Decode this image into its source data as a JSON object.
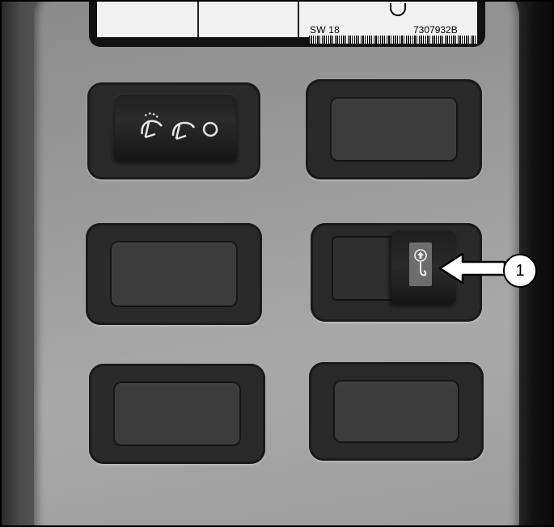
{
  "label_plate": {
    "switch_id": "SW 18",
    "part_number": "7307932B"
  },
  "switch_panel": {
    "slots": [
      {
        "position": "top-left",
        "state": "wiper switch",
        "icons": [
          "washer-wiper-icon",
          "wiper-icon",
          "off-circle-icon"
        ]
      },
      {
        "position": "top-right",
        "state": "blank"
      },
      {
        "position": "middle-left",
        "state": "blank"
      },
      {
        "position": "middle-right",
        "state": "toggle switch",
        "icons": [
          "up-arrow-hook-icon"
        ]
      },
      {
        "position": "bottom-left",
        "state": "blank"
      },
      {
        "position": "bottom-right",
        "state": "blank"
      }
    ]
  },
  "callout": {
    "number": "1"
  },
  "colors": {
    "panel": "#9a9a9a",
    "bezel": "#2a2a2a",
    "callout": "#000000"
  }
}
